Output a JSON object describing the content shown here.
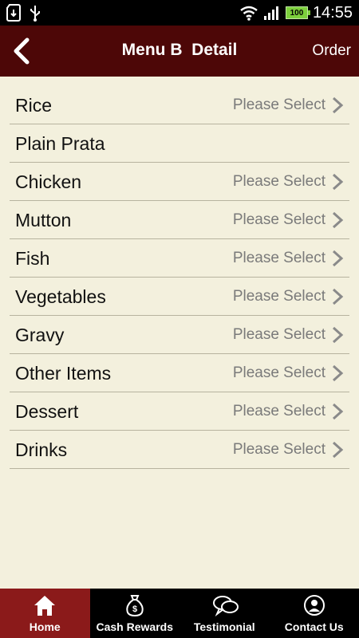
{
  "status_bar": {
    "time": "14:55",
    "battery": "100"
  },
  "header": {
    "title": "Menu B  Detail",
    "order_label": "Order"
  },
  "menu_items": [
    {
      "label": "Rice",
      "value": "Please Select"
    },
    {
      "label": "Plain Prata",
      "value": ""
    },
    {
      "label": "Chicken",
      "value": "Please Select"
    },
    {
      "label": "Mutton",
      "value": "Please Select"
    },
    {
      "label": "Fish",
      "value": "Please Select"
    },
    {
      "label": "Vegetables",
      "value": "Please Select"
    },
    {
      "label": "Gravy",
      "value": "Please Select"
    },
    {
      "label": "Other Items",
      "value": "Please Select"
    },
    {
      "label": "Dessert",
      "value": "Please Select"
    },
    {
      "label": "Drinks",
      "value": "Please Select"
    }
  ],
  "tabs": [
    {
      "label": "Home",
      "icon": "home-icon",
      "active": true
    },
    {
      "label": "Cash Rewards",
      "icon": "money-bag-icon",
      "active": false
    },
    {
      "label": "Testimonial",
      "icon": "chat-bubbles-icon",
      "active": false
    },
    {
      "label": "Contact Us",
      "icon": "contact-icon",
      "active": false
    }
  ],
  "colors": {
    "header_bg": "#4d0707",
    "active_tab": "#8b1a1a",
    "background": "#f3f0dd"
  }
}
